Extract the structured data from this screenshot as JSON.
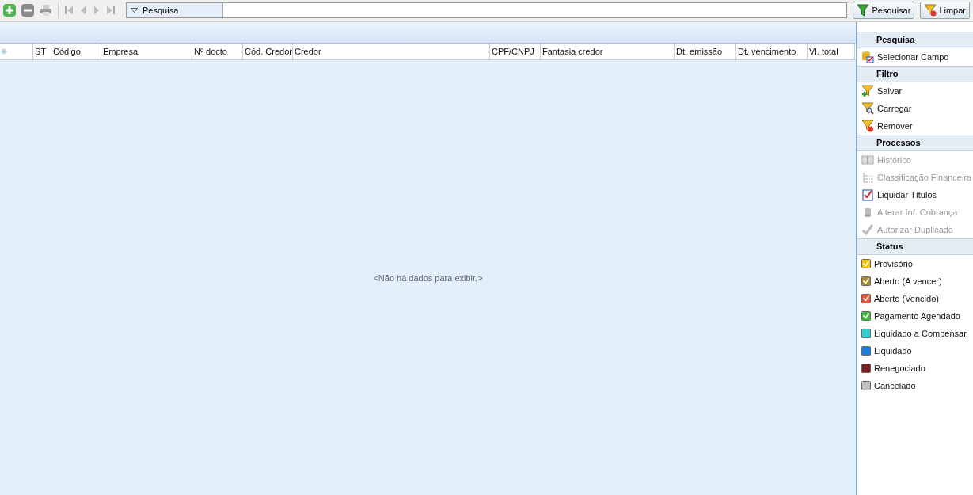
{
  "search_bar": {
    "dropdown_label": "Pesquisa",
    "buttons": [
      {
        "label": "Pesquisar",
        "kind": "search"
      },
      {
        "label": "Limpar",
        "kind": "clear"
      }
    ]
  },
  "table": {
    "columns": [
      "",
      "ST",
      "Código",
      "Empresa",
      "Nº docto",
      "Cód. Credor",
      "Credor",
      "CPF/CNPJ",
      "Fantasia credor",
      "Dt. emissão",
      "Dt. vencimento",
      "Vl. total"
    ],
    "empty_message": "<Não há dados para exibir.>"
  },
  "side_panel": {
    "sections": [
      {
        "title": "Pesquisa",
        "items": [
          {
            "label": "Selecionar Campo",
            "disabled": false
          }
        ]
      },
      {
        "title": "Filtro",
        "items": [
          {
            "label": "Salvar",
            "disabled": false
          },
          {
            "label": "Carregar",
            "disabled": false
          },
          {
            "label": "Remover",
            "disabled": false
          }
        ]
      },
      {
        "title": "Processos",
        "items": [
          {
            "label": "Histórico",
            "disabled": true
          },
          {
            "label": "Classificação Financeira",
            "disabled": true
          },
          {
            "label": "Liquidar Títulos",
            "disabled": false
          },
          {
            "label": "Alterar Inf. Cobrança",
            "disabled": true
          },
          {
            "label": "Autorizar Duplicado",
            "disabled": true
          }
        ]
      }
    ],
    "status": {
      "title": "Status",
      "items": [
        {
          "label": "Provisório",
          "color": "#f5c400",
          "checked": true
        },
        {
          "label": "Aberto (A vencer)",
          "color": "#b08a2a",
          "checked": true
        },
        {
          "label": "Aberto (Vencido)",
          "color": "#f05030",
          "checked": true
        },
        {
          "label": "Pagamento Agendado",
          "color": "#3cc03c",
          "checked": true
        },
        {
          "label": "Liquidado a Compensar",
          "color": "#30d0d0",
          "checked": false
        },
        {
          "label": "Liquidado",
          "color": "#1a7de0",
          "checked": false
        },
        {
          "label": "Renegociado",
          "color": "#7a1e1e",
          "checked": false
        },
        {
          "label": "Cancelado",
          "color": "#c0c0c0",
          "checked": false
        }
      ]
    }
  }
}
